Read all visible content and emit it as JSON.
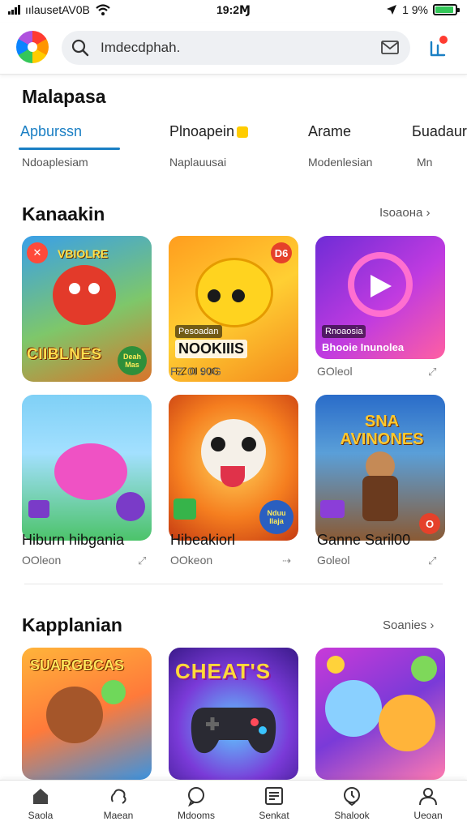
{
  "status_bar": {
    "carrier": "ıılausetAV0B",
    "time": "19:2Ɱ",
    "battery": "1 9%",
    "battery_level": 0.9,
    "icons": [
      "signal-icon",
      "wifi-icon",
      "location-icon",
      "battery-icon"
    ]
  },
  "header": {
    "logo": "app-logo",
    "search_text": "Imdecdphah.",
    "icons": [
      "search-icon",
      "mail-icon",
      "notification-icon"
    ]
  },
  "category_section": {
    "title": "Malapasa",
    "tabs": [
      {
        "label": "Apburssn",
        "sub": "Ndoaplesiam"
      },
      {
        "label": "Plnoapein",
        "sub": "Naplauusai"
      },
      {
        "label": "Arame",
        "sub": "Modenlesian"
      },
      {
        "label": "Бuadaur",
        "sub": "Mn"
      }
    ]
  },
  "section1": {
    "title": "Kanaakin",
    "see_all": "Isoaoна ›",
    "cards": [
      {
        "art_badge": "✕",
        "art_top": "VBIOLRE",
        "art_title": "CIIBLNES",
        "art_tag": "Deah Mas"
      },
      {
        "art_badge": "D6",
        "art_label": "Pesoadan",
        "art_title": "NOOKIIIS",
        "art_small": "FZ 0I 90G",
        "meta": "FZ 0I 90G"
      },
      {
        "art_label": "Rnoaosia",
        "art_title": "Bhooie Inunolea",
        "meta": "GOleol"
      }
    ],
    "cards_row2": [
      {
        "name": "Hiburn hibgania",
        "meta": "OOleon"
      },
      {
        "art_tag": "Nduu Ilaja",
        "name": "Hibeakiorl",
        "meta": "OOkeon"
      },
      {
        "art_title": "SNA AVINONES",
        "name": "Ganne Saril00",
        "meta": "Goleol",
        "art_badge": "O"
      }
    ]
  },
  "section2": {
    "title": "Kapplanian",
    "see_all": "Soanies ›",
    "cards": [
      {
        "art_title": "SUARGBCAS"
      },
      {
        "art_title": "CHEAT'S"
      },
      {
        "art_title": ""
      }
    ]
  },
  "bottom_nav": [
    {
      "label": "Saola",
      "icon": "home-icon"
    },
    {
      "label": "Maean",
      "icon": "games-icon"
    },
    {
      "label": "Mdooms",
      "icon": "chat-icon"
    },
    {
      "label": "Senkat",
      "icon": "list-icon"
    },
    {
      "label": "Shalook",
      "icon": "clock-icon"
    },
    {
      "label": "Ueoan",
      "icon": "profile-icon"
    }
  ],
  "colors": {
    "accent": "#1a7fc4",
    "notification": "#ff3b30",
    "battery": "#34c759"
  }
}
